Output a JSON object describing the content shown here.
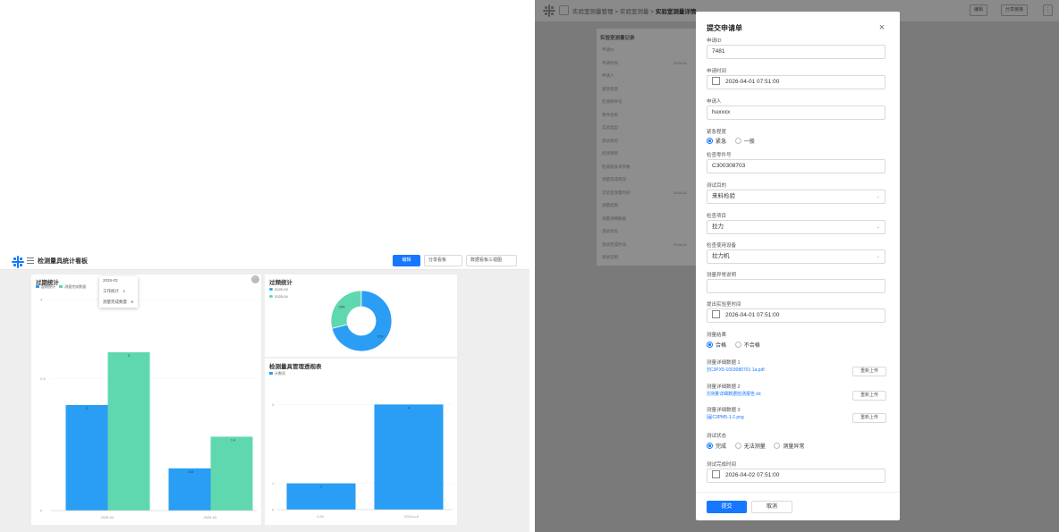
{
  "left": {
    "title": "检测量具统计看板",
    "buttons": {
      "edit": "编辑",
      "share": "分享看板",
      "dashboard": "数据看板三视图"
    },
    "more_glyph": "···",
    "tooltip": {
      "header": "2025-03",
      "row1_label": "工作统计",
      "row1_value": "1",
      "row2_label": "测量完成数量",
      "row2_value": "6"
    },
    "axis_tick_label": "2026-05"
  },
  "chart_data": [
    {
      "type": "bar",
      "title": "过期统计",
      "categories": [
        "2025-03",
        "2025-04"
      ],
      "series": [
        {
          "name": "超期统计",
          "values": [
            2,
            0.8
          ]
        },
        {
          "name": "测量完成数量",
          "values": [
            3,
            1.4
          ]
        }
      ],
      "ylim": [
        0,
        4
      ],
      "y_ticks": [
        "4",
        "2.5",
        "0"
      ],
      "colors": [
        "#2a9df4",
        "#5fd8b0"
      ]
    },
    {
      "type": "pie",
      "title": "过频统计",
      "series_labels": [
        "2025-03",
        "2025-04"
      ],
      "values": [
        71,
        29
      ],
      "labels": [
        "71%",
        "29%"
      ],
      "colors": [
        "#2a9df4",
        "#5fd8b0"
      ]
    },
    {
      "type": "bar",
      "title": "检测量具管理透视表",
      "legend": "计数项",
      "categories": [
        "1.00",
        "2024-a-b"
      ],
      "values": [
        1,
        4
      ],
      "ylim": [
        0,
        5
      ],
      "y_ticks": [
        "1",
        "4",
        "0"
      ],
      "colors": [
        "#2a9df4"
      ]
    }
  ],
  "right": {
    "breadcrumb": {
      "part1": "实验室测量管理",
      "sep": ">",
      "part2": "实验室测量",
      "part3": "实验室测量详情"
    },
    "buttons": {
      "edit": "编辑",
      "share": "分享链接",
      "more": "⋮"
    },
    "bg_card": {
      "title": "实验室测量记录",
      "rows": [
        {
          "label": "申请ID",
          "value": ""
        },
        {
          "label": "申请时间",
          "value": "2026-04"
        },
        {
          "label": "申请人",
          "value": ""
        },
        {
          "label": "紧急程度",
          "value": ""
        },
        {
          "label": "检测样件号",
          "value": ""
        },
        {
          "label": "零件名称",
          "value": ""
        },
        {
          "label": "实验类型",
          "value": ""
        },
        {
          "label": "测试目的",
          "value": ""
        },
        {
          "label": "检测项目",
          "value": ""
        },
        {
          "label": "检测前技术参数",
          "value": ""
        },
        {
          "label": "测量完成情况",
          "value": ""
        },
        {
          "label": "实验室测量时间",
          "value": "2026-04"
        },
        {
          "label": "测量结果",
          "value": ""
        },
        {
          "label": "测量详细数据",
          "value": ""
        },
        {
          "label": "测试状态",
          "value": ""
        },
        {
          "label": "测试完成时间",
          "value": "2026-04"
        },
        {
          "label": "测试说明",
          "value": ""
        }
      ]
    }
  },
  "modal": {
    "title": "提交申请单",
    "close": "×",
    "fields": {
      "apply_id": {
        "label": "申请ID",
        "value": "7481"
      },
      "apply_time": {
        "label": "申请时间",
        "value": "2026-04-01  07:51:00"
      },
      "applicant": {
        "label": "申请人",
        "value": "huxxxx"
      },
      "urgency": {
        "label": "紧急程度",
        "options": [
          "紧急",
          "一般"
        ],
        "selected": "紧急"
      },
      "sample_no": {
        "label": "检查零件号",
        "value": "C300308703"
      },
      "test_purpose": {
        "label": "测试目的",
        "value": "来料检验"
      },
      "test_type": {
        "label": "检查项目",
        "value": "拉力"
      },
      "test_equipment": {
        "label": "检查使用设备",
        "value": "拉力机"
      },
      "remark": {
        "label": "测量异常说明",
        "value": ""
      },
      "lab_time": {
        "label": "提出实验室时间",
        "value": "2026-04-01  07:51:00"
      },
      "result": {
        "label": "测量结果",
        "options": [
          "合格",
          "不合格"
        ],
        "selected": "合格"
      },
      "data1": {
        "label": "测量详细数据 1",
        "file": "C3PX5-1003080701 1a.pdf",
        "button": "重新上传"
      },
      "data2": {
        "label": "测量详细数据 2",
        "file": "测量详细数据检测报告.txt",
        "button": "重新上传"
      },
      "data3": {
        "label": "测量详细数据 3",
        "file": "C3PM5-1-2.png",
        "button": "重新上传"
      },
      "status": {
        "label": "测试状态",
        "options": [
          "完成",
          "无法测量",
          "测量异常"
        ],
        "selected": "完成"
      },
      "finish_time": {
        "label": "测试完成时间",
        "value": "2026-04-02  07:51:00"
      }
    },
    "footer": {
      "submit": "提交",
      "cancel": "取消"
    }
  }
}
